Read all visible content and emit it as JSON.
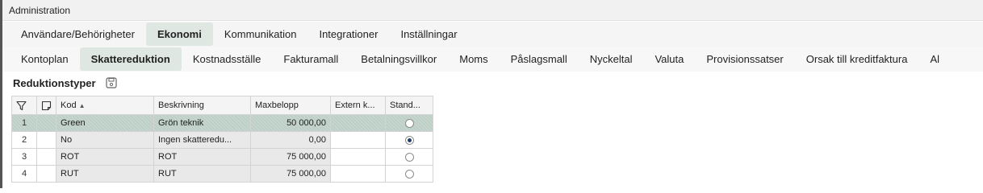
{
  "window": {
    "title": "Administration"
  },
  "main_tabs": [
    {
      "label": "Användare/Behörigheter",
      "active": false
    },
    {
      "label": "Ekonomi",
      "active": true
    },
    {
      "label": "Kommunikation",
      "active": false
    },
    {
      "label": "Integrationer",
      "active": false
    },
    {
      "label": "Inställningar",
      "active": false
    }
  ],
  "sub_tabs": [
    {
      "label": "Kontoplan",
      "active": false
    },
    {
      "label": "Skattereduktion",
      "active": true
    },
    {
      "label": "Kostnadsställe",
      "active": false
    },
    {
      "label": "Fakturamall",
      "active": false
    },
    {
      "label": "Betalningsvillkor",
      "active": false
    },
    {
      "label": "Moms",
      "active": false
    },
    {
      "label": "Påslagsmall",
      "active": false
    },
    {
      "label": "Nyckeltal",
      "active": false
    },
    {
      "label": "Valuta",
      "active": false
    },
    {
      "label": "Provisionssatser",
      "active": false
    },
    {
      "label": "Orsak till kreditfaktura",
      "active": false
    },
    {
      "label": "Al",
      "active": false
    }
  ],
  "section": {
    "title": "Reduktionstyper"
  },
  "grid": {
    "columns": [
      "Kod",
      "Beskrivning",
      "Maxbelopp",
      "Extern k...",
      "Stand..."
    ],
    "sort_indicator": "▲",
    "rows": [
      {
        "num": "1",
        "kod": "Green",
        "beskrivning": "Grön teknik",
        "maxbelopp": "50 000,00",
        "extern": "",
        "standard": false
      },
      {
        "num": "2",
        "kod": "No",
        "beskrivning": "Ingen skatteredu...",
        "maxbelopp": "0,00",
        "extern": "",
        "standard": true
      },
      {
        "num": "3",
        "kod": "ROT",
        "beskrivning": "ROT",
        "maxbelopp": "75 000,00",
        "extern": "",
        "standard": false
      },
      {
        "num": "4",
        "kod": "RUT",
        "beskrivning": "RUT",
        "maxbelopp": "75 000,00",
        "extern": "",
        "standard": false
      }
    ],
    "selected_row": 0
  },
  "icons": {
    "save": "save-icon",
    "filter": "filter-icon",
    "note": "note-icon"
  },
  "colors": {
    "active_tab": "#dfe7e3",
    "selected_row": "#c5d6ce",
    "radio_selected": "#1f3f66"
  }
}
